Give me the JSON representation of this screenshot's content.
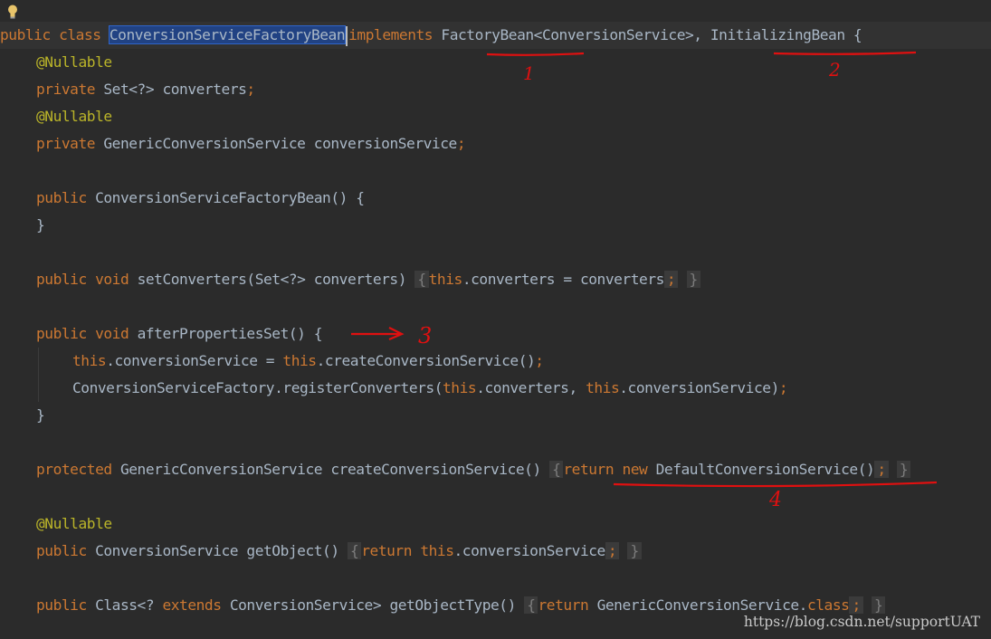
{
  "annotation_marks": [
    "1",
    "2",
    "3",
    "4"
  ],
  "code": {
    "l1": {
      "public": "public",
      "class": "class",
      "classname": "ConversionServiceFactoryBean",
      "implements": "implements",
      "factorybean": "FactoryBean",
      "generic": "<ConversionService>,",
      "initializingbean": "InitializingBean",
      "brace": "{"
    },
    "l2": {
      "annotation": "@Nullable"
    },
    "l3": {
      "private": "private",
      "type": "Set<?>",
      "field": "converters",
      "semi": ";"
    },
    "l4": {
      "annotation": "@Nullable"
    },
    "l5": {
      "private": "private",
      "type": "GenericConversionService",
      "field": "conversionService",
      "semi": ";"
    },
    "l6": {
      "public": "public",
      "ctor": "ConversionServiceFactoryBean() {"
    },
    "l7": {
      "brace": "}"
    },
    "l8": {
      "public": "public",
      "void": "void",
      "sig": "setConverters(Set<?> converters)",
      "ob": "{",
      "this": "this",
      "body": ".converters = converters",
      "semi": ";",
      "cb": "}"
    },
    "l9": {
      "public": "public",
      "void": "void",
      "sig": "afterPropertiesSet() {"
    },
    "l10": {
      "this1": "this",
      "a": ".conversionService = ",
      "this2": "this",
      "b": ".createConversionService()",
      "semi": ";"
    },
    "l11": {
      "a": "ConversionServiceFactory.registerConverters(",
      "this1": "this",
      "b": ".converters,",
      "this2": "this",
      "c": ".conversionService)",
      "semi": ";"
    },
    "l12": {
      "brace": "}"
    },
    "l13": {
      "protected": "protected",
      "sig": "GenericConversionService createConversionService()",
      "ob": "{",
      "return": "return",
      "new": "new",
      "body": "DefaultConversionService()",
      "semi": ";",
      "cb": "}"
    },
    "l14": {
      "annotation": "@Nullable"
    },
    "l15": {
      "public": "public",
      "sig": "ConversionService getObject()",
      "ob": "{",
      "return": "return",
      "this": "this",
      "body": ".conversionService",
      "semi": ";",
      "cb": "}"
    },
    "l16": {
      "public": "public",
      "a": "Class<?",
      "extends": "extends",
      "b": "ConversionService> getObjectType()",
      "ob": "{",
      "return": "return",
      "body": "GenericConversionService.",
      "cls": "class",
      "semi": ";",
      "cb": "}"
    }
  },
  "watermark": "https://blog.csdn.net/supportUAT",
  "colors": {
    "background": "#2b2b2b",
    "keyword": "#cc7832",
    "annotation": "#bbb529",
    "text": "#a9b7c6",
    "selection": "#214283",
    "marker": "#e01010"
  }
}
